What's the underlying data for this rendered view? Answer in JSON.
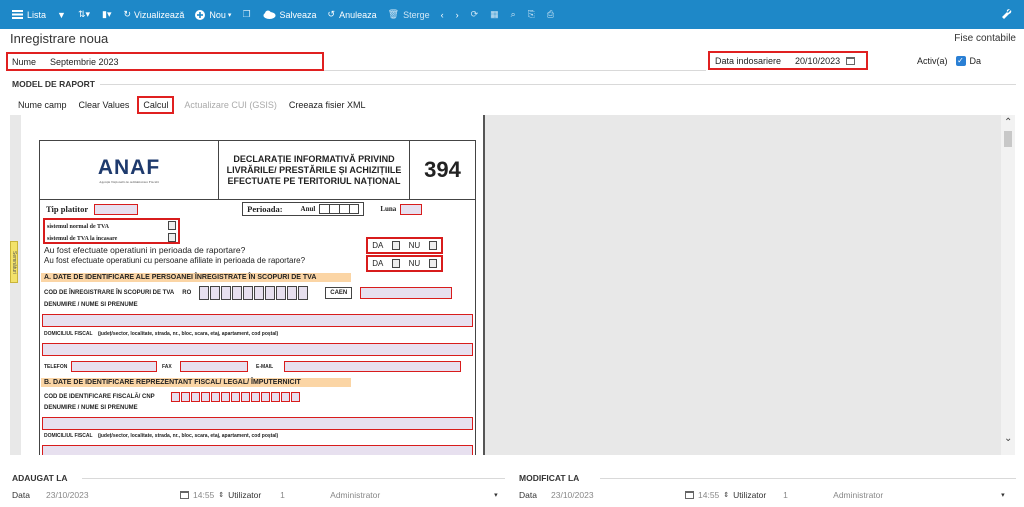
{
  "toolbar": {
    "lista": "Lista",
    "vizualizeaza": "Vizualizează",
    "nou": "Nou",
    "salveaza": "Salveaza",
    "anuleaza": "Anuleaza",
    "sterge": "Sterge"
  },
  "page": {
    "title": "Inregistrare noua",
    "fise_contabile": "Fise contabile"
  },
  "form": {
    "nume_label": "Nume",
    "nume_value": "Septembrie 2023",
    "data_ind_label": "Data indosariere",
    "data_ind_value": "20/10/2023",
    "activ_label": "Activ(a)",
    "activ_value": "Da"
  },
  "model": {
    "heading": "MODEL DE RAPORT",
    "tabs": [
      "Nume camp",
      "Clear Values",
      "Calcul",
      "Actualizare CUI (GSIS)",
      "Creeaza fisier XML"
    ]
  },
  "pdf": {
    "logo": "ANAF",
    "logo_sub": "Agenția Națională de Administrare Fiscală",
    "title_l1": "DECLARAȚIE INFORMATIVĂ PRIVIND",
    "title_l2": "LIVRĂRILE/ PRESTĂRILE ȘI ACHIZIȚIILE",
    "title_l3": "EFECTUATE PE TERITORIUL NAȚIONAL",
    "number": "394",
    "tip_platitor": "Tip platitor",
    "perioada": "Perioada:",
    "anul": "Anul",
    "luna": "Luna",
    "sist_normal": "sistemul normal de TVA",
    "sist_incasare": "sistemul de TVA la incasare",
    "q1": "Au fost efectuate operatiuni in perioada de raportare?",
    "q2": "Au fost efectuate operatiuni cu persoane afiliate  in perioada de raportare?",
    "da": "DA",
    "nu": "NU",
    "sec_a": "A. DATE DE IDENTIFICARE ALE PERSOANEI ÎNREGISTRATE ÎN SCOPURI DE TVA",
    "cod_inreg": "COD DE ÎNREGISTRARE ÎN SCOPURI DE TVA",
    "ro": "RO",
    "caen": "CAEN",
    "denumire": "DENUMIRE / NUME SI PRENUME",
    "domiciliu": "DOMICILIUL FISCAL",
    "domiciliu_detail": "(județ/sector, localitate, strada, nr., bloc, scara, etaj, apartament, cod poștal)",
    "telefon": "TELEFON",
    "fax": "FAX",
    "email": "E-MAIL",
    "sec_b": "B. DATE DE IDENTIFICARE REPREZENTANT FISCAL/ LEGAL/ ÎMPUTERNICIT",
    "cod_ident": "COD DE IDENTIFICARE FISCALĂ/ CNP",
    "sidebar_tab": "Semnături"
  },
  "footer": {
    "adaugat_heading": "ADAUGAT LA",
    "modificat_heading": "MODIFICAT LA",
    "data_label": "Data",
    "adaugat_date": "23/10/2023",
    "adaugat_time": "14:55",
    "utilizator_label": "Utilizator",
    "adaugat_user_id": "1",
    "adaugat_user": "Administrator",
    "modificat_date": "23/10/2023",
    "modificat_time": "14:55",
    "modificat_user_id": "1",
    "modificat_user": "Administrator"
  },
  "colors": {
    "toolbar": "#1e88c8",
    "highlight": "#e02020",
    "field_fill": "#e7e0ef",
    "section_fill": "#fbd5a5"
  }
}
